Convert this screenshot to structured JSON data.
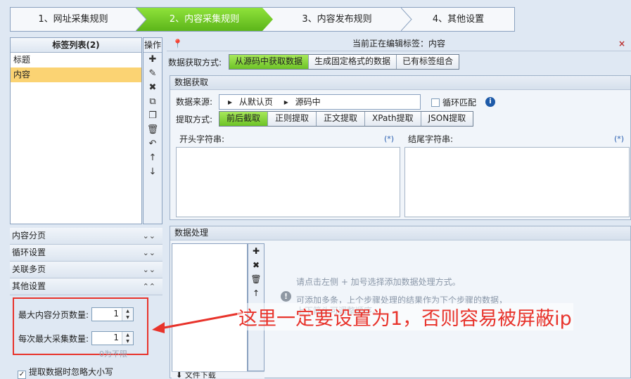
{
  "steps": [
    "1、网址采集规则",
    "2、内容采集规则",
    "3、内容发布规则",
    "4、其他设置"
  ],
  "tag_panel": {
    "header": "标签列表(2)",
    "items": [
      "标题",
      "内容"
    ],
    "ops_header": "操作"
  },
  "right_header": {
    "title": "当前正在编辑标签：内容",
    "close": "×"
  },
  "data_method": {
    "label": "数据获取方式:",
    "options": [
      "从源码中获取数据",
      "生成固定格式的数据",
      "已有标签组合"
    ],
    "selected": "从源码中获取数据"
  },
  "data_fetch": {
    "title": "数据获取",
    "source_label": "数据来源:",
    "source_path": [
      "从默认页",
      "源码中"
    ],
    "loop_match_label": "循环匹配",
    "extract_label": "提取方式:",
    "extract_options": [
      "前后截取",
      "正则提取",
      "正文提取",
      "XPath提取",
      "JSON提取"
    ],
    "extract_selected": "前后截取",
    "start_label": "开头字符串:",
    "end_label": "结尾字符串:",
    "wildcard": "(*)"
  },
  "accordion": [
    "内容分页",
    "循环设置",
    "关联多页",
    "其他设置"
  ],
  "other_settings": {
    "max_pages_label": "最大内容分页数量:",
    "max_pages_value": "1",
    "max_collect_label": "每次最大采集数量:",
    "max_collect_value": "1",
    "no_limit_hint": "0为不限"
  },
  "ignore_case_label": "提取数据时忽略大小写",
  "processing": {
    "title": "数据处理",
    "hint": "请点击左侧 + 加号选择添加数据处理方式。",
    "info": "可添加多条，上个步骤处理的结果作为下个步骤的数据，上下箭头可调整顺序。",
    "footer": "文件下载"
  },
  "annotation": "这里一定要设置为1，否则容易被屏蔽ip",
  "colors": {
    "accent_green": "#6dc326",
    "selected_row": "#fbd373",
    "annotation_red": "#e8332b"
  }
}
